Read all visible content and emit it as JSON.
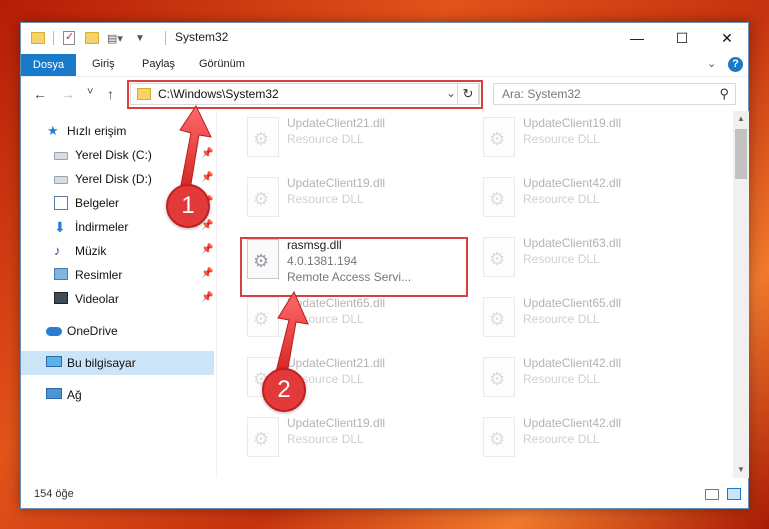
{
  "window": {
    "title": "System32",
    "controls": {
      "minimize": "—",
      "maximize": "☐",
      "close": "✕"
    }
  },
  "ribbon": {
    "file_tab": "Dosya",
    "tabs": [
      "Giriş",
      "Paylaş",
      "Görünüm"
    ],
    "help": "?"
  },
  "nav": {
    "back": "←",
    "forward": "→",
    "recent": "˅",
    "up": "↑",
    "address": "C:\\Windows\\System32",
    "refresh": "↻",
    "search_placeholder": "Ara: System32"
  },
  "sidebar": {
    "items": [
      {
        "label": "Hızlı erişim",
        "icon": "star-icon"
      },
      {
        "label": "Yerel Disk (C:)",
        "icon": "drive-icon"
      },
      {
        "label": "Yerel Disk (D:)",
        "icon": "drive-icon"
      },
      {
        "label": "Belgeler",
        "icon": "documents-icon"
      },
      {
        "label": "İndirmeler",
        "icon": "download-icon"
      },
      {
        "label": "Müzik",
        "icon": "music-icon"
      },
      {
        "label": "Resimler",
        "icon": "pictures-icon"
      },
      {
        "label": "Videolar",
        "icon": "videos-icon"
      },
      {
        "label": "OneDrive",
        "icon": "cloud-icon"
      },
      {
        "label": "Bu bilgisayar",
        "icon": "computer-icon"
      },
      {
        "label": "Ağ",
        "icon": "network-icon"
      }
    ]
  },
  "files": [
    {
      "name": "UpdateClient21.dll",
      "type": "Resource DLL"
    },
    {
      "name": "UpdateClient19.dll",
      "type": "Resource DLL"
    },
    {
      "name": "UpdateClient19.dll",
      "type": "Resource DLL"
    },
    {
      "name": "UpdateClient42.dll",
      "type": "Resource DLL"
    },
    {
      "name": "rasmsg.dll",
      "version": "4.0.1381.194",
      "description": "Remote Access Servi..."
    },
    {
      "name": "UpdateClient63.dll",
      "type": "Resource DLL"
    },
    {
      "name": "UpdateClient65.dll",
      "type": "Resource DLL"
    },
    {
      "name": "UpdateClient65.dll",
      "type": "Resource DLL"
    },
    {
      "name": "UpdateClient21.dll",
      "type": "Resource DLL"
    },
    {
      "name": "UpdateClient42.dll",
      "type": "Resource DLL"
    },
    {
      "name": "UpdateClient19.dll",
      "type": "Resource DLL"
    },
    {
      "name": "UpdateClient42.dll",
      "type": "Resource DLL"
    }
  ],
  "status": {
    "count": "154 öğe"
  },
  "annotations": {
    "step1": "1",
    "step2": "2",
    "color": "#e23a3a"
  }
}
